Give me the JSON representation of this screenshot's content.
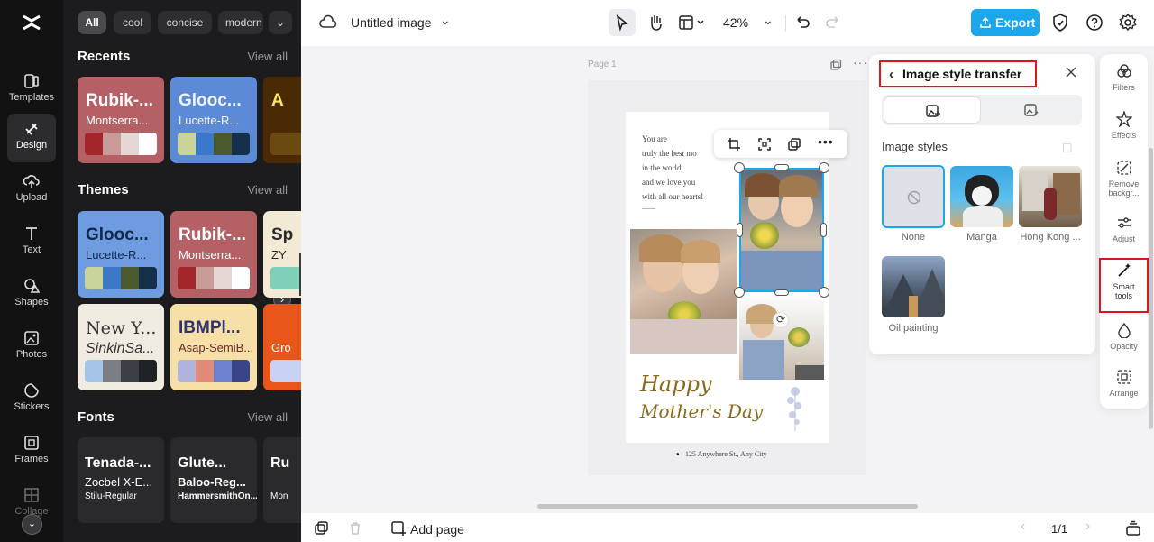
{
  "nav": {
    "items": [
      {
        "label": "Templates",
        "icon": "templates-icon"
      },
      {
        "label": "Design",
        "icon": "design-icon"
      },
      {
        "label": "Upload",
        "icon": "upload-icon"
      },
      {
        "label": "Text",
        "icon": "text-icon"
      },
      {
        "label": "Shapes",
        "icon": "shapes-icon"
      },
      {
        "label": "Photos",
        "icon": "photos-icon"
      },
      {
        "label": "Stickers",
        "icon": "stickers-icon"
      },
      {
        "label": "Frames",
        "icon": "frames-icon"
      },
      {
        "label": "Collage",
        "icon": "collage-icon"
      }
    ]
  },
  "panel": {
    "chips": [
      "All",
      "cool",
      "concise",
      "modern"
    ],
    "recents": {
      "title": "Recents",
      "view_all": "View all",
      "cards": [
        {
          "t1": "Rubik-...",
          "t2": "Montserra...",
          "colors": [
            "#a3262a",
            "#c89a98",
            "#e6d6d4",
            "#ffffff"
          ],
          "bg": "#b56064",
          "fg": "#ffffff"
        },
        {
          "t1": "Glooc...",
          "t2": "Lucette-R...",
          "colors": [
            "#c9d49a",
            "#3c78c8",
            "#4b5a2e",
            "#14304a"
          ],
          "bg": "#5c8ad6",
          "fg": "#f3f3f3"
        },
        {
          "t1": "A",
          "t2": "",
          "colors": [
            "#6a4a10"
          ],
          "bg": "#4a2a05",
          "fg": "#ffe36b"
        }
      ]
    },
    "themes": {
      "title": "Themes",
      "view_all": "View all",
      "cards": [
        {
          "t1": "Glooc...",
          "t2": "Lucette-R...",
          "colors": [
            "#c9d49a",
            "#3c78c8",
            "#4b5a2e",
            "#14304a"
          ],
          "bg": "#5c8ad6",
          "fg": "#0e2a4a"
        },
        {
          "t1": "Rubik-...",
          "t2": "Montserra...",
          "colors": [
            "#a3262a",
            "#c89a98",
            "#e6d6d4",
            "#ffffff"
          ],
          "bg": "#b56064",
          "fg": "#ffffff"
        },
        {
          "t1": "Sp",
          "t2": "ZY",
          "colors": [
            "#7fd0b8"
          ],
          "bg": "#f2ead5",
          "fg": "#2a2a2a"
        },
        {
          "t1": "New Y...",
          "t2": "SinkinSa...",
          "colors": [
            "#a4c4ea",
            "#7a7d82",
            "#3c3f46",
            "#1e2126"
          ],
          "bg": "#f0ebe1",
          "fg": "#333333"
        },
        {
          "t1": "IBMPl...",
          "t2": "Asap-SemiB...",
          "colors": [
            "#b0b4dc",
            "#e28a78",
            "#6c84d0",
            "#3a4488"
          ],
          "bg": "#f7dfa8",
          "fg": "#2d3570"
        },
        {
          "t1": "",
          "t2": "Gro",
          "colors": [
            "#c8d0f4"
          ],
          "bg": "#e8561a",
          "fg": "#ffffff"
        }
      ]
    },
    "fonts": {
      "title": "Fonts",
      "view_all": "View all",
      "cards": [
        {
          "t1": "Tenada-...",
          "t2": "Zocbel X-E...",
          "t3": "Stilu-Regular"
        },
        {
          "t1": "Glute...",
          "t2": "Baloo-Reg...",
          "t3": "HammersmithOn..."
        },
        {
          "t1": "Ru",
          "t2": "",
          "t3": "Mon"
        }
      ]
    }
  },
  "topbar": {
    "title": "Untitled image",
    "zoom": "42%",
    "export_label": "Export",
    "accent": "#1aa7ec"
  },
  "canvas": {
    "page_label": "Page 1",
    "poster": {
      "intro_lines": [
        "You are",
        "truly the best mo",
        "in the world,",
        "and we love you",
        "with all our hearts!"
      ],
      "headline1": "Happy",
      "headline2": "Mother's Day",
      "address": "125 Anywhere St., Any City"
    }
  },
  "style_panel": {
    "title": "Image style transfer",
    "section_title": "Image styles",
    "styles": [
      {
        "label": "None"
      },
      {
        "label": "Manga"
      },
      {
        "label": "Hong Kong ..."
      },
      {
        "label": "Oil painting"
      }
    ]
  },
  "rail": {
    "items": [
      {
        "label": "Filters"
      },
      {
        "label": "Effects"
      },
      {
        "label": "Remove backgr..."
      },
      {
        "label": "Adjust"
      },
      {
        "label": "Smart tools"
      },
      {
        "label": "Opacity"
      },
      {
        "label": "Arrange"
      }
    ]
  },
  "bottombar": {
    "add_page": "Add page",
    "page_count": "1/1"
  }
}
